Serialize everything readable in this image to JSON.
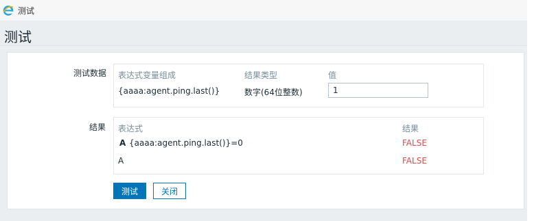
{
  "window": {
    "title": "测试"
  },
  "page": {
    "title": "测试"
  },
  "test_data": {
    "label": "测试数据",
    "headers": [
      "表达式变量组成",
      "结果类型",
      "值"
    ],
    "row": {
      "expression": "{aaaa:agent.ping.last()}",
      "type": "数字(64位整数)",
      "value": "1"
    }
  },
  "results": {
    "label": "结果",
    "headers": [
      "表达式",
      "结果"
    ],
    "rows": [
      {
        "prefix": "A",
        "expression": "{aaaa:agent.ping.last()}=0",
        "result": "FALSE"
      },
      {
        "prefix": "A",
        "expression": "",
        "result": "FALSE"
      }
    ]
  },
  "buttons": {
    "test": "测试",
    "close": "关闭"
  },
  "colors": {
    "primary": "#0275b8",
    "false": "#d64e4e",
    "header_text": "#768d99"
  },
  "icons": {
    "app": "ie-e-icon"
  }
}
